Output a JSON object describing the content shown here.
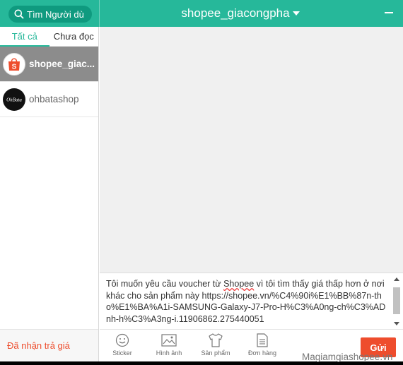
{
  "header": {
    "search_label": "Tìm Người dù",
    "title": "shopee_giacongpha"
  },
  "tabs": [
    {
      "label": "Tất cả",
      "active": true
    },
    {
      "label": "Chưa đọc",
      "active": false
    }
  ],
  "conversations": [
    {
      "name": "shopee_giac...",
      "avatar": "shopee-logo-icon",
      "avatar_text": "S",
      "active": true
    },
    {
      "name": "ohbatashop",
      "avatar": "ohbatashop-logo-icon",
      "avatar_text": "OhBata",
      "active": false
    }
  ],
  "left_footer": {
    "label": "Đã nhận trả giá"
  },
  "compose": {
    "text_before": "Tôi muốn yêu cầu voucher từ ",
    "text_brand": "Shopee",
    "text_after": " vì tôi tìm thấy giá thấp hơn ở nơi khác cho sản phẩm này https://shopee.vn/%C4%90i%E1%BB%87n-tho%E1%BA%A1i-SAMSUNG-Galaxy-J7-Pro-H%C3%A0ng-ch%C3%ADnh-h%C3%A3ng-i.11906862.275440051"
  },
  "toolbar": {
    "sticker": "Sticker",
    "image": "Hình ảnh",
    "product": "Sản phẩm",
    "order": "Đơn hàng",
    "send": "Gửi"
  },
  "watermark": "Magiamgiashopee.vn",
  "colors": {
    "accent": "#26b89a",
    "brand": "#ee4d2d",
    "selected": "#8c8c8c"
  }
}
